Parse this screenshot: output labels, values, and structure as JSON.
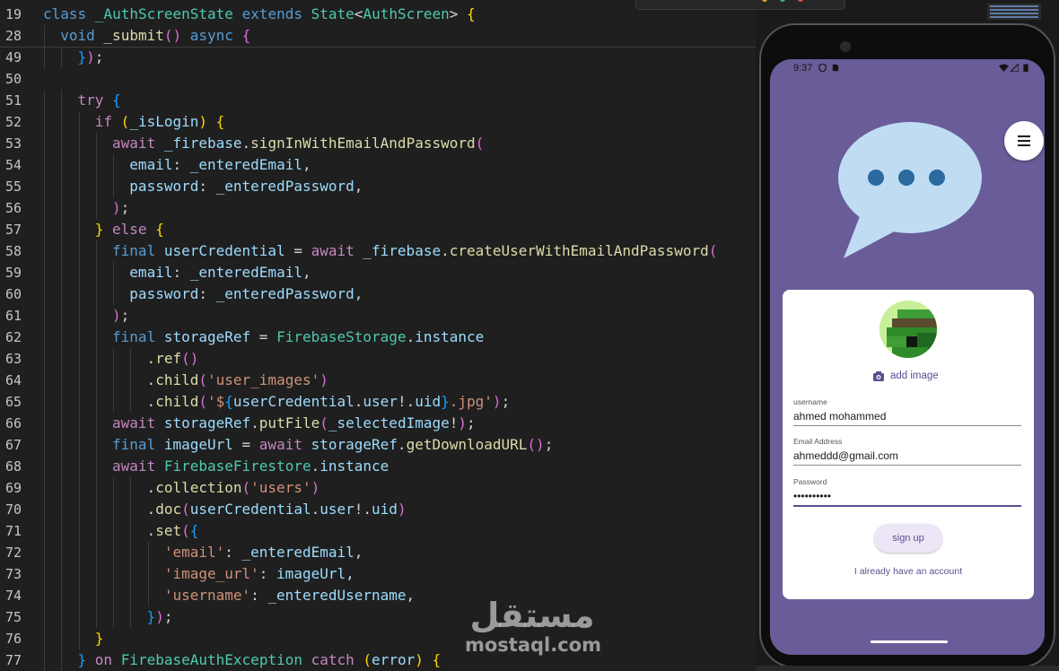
{
  "colors": {
    "editor_bg": "#1f1f1f",
    "screen_bg": "#695c99",
    "card_bg": "#ffffff",
    "accent": "#5a4f8e",
    "bubble": "#bfdcf3",
    "dots": "#2a6a9f"
  },
  "editor": {
    "lines": [
      {
        "num": "19",
        "indent": 0,
        "tokens": [
          [
            "kb",
            "class "
          ],
          [
            "t",
            "_AuthScreenState "
          ],
          [
            "kb",
            "extends "
          ],
          [
            "t",
            "State"
          ],
          [
            "p",
            "<"
          ],
          [
            "t",
            "AuthScreen"
          ],
          [
            "p",
            "> "
          ],
          [
            "br1",
            "{"
          ]
        ]
      },
      {
        "num": "28",
        "indent": 1,
        "tokens": [
          [
            "kb",
            "void "
          ],
          [
            "f",
            "_submit"
          ],
          [
            "br2",
            "()"
          ],
          [
            "kb",
            " async "
          ],
          [
            "br2",
            "{"
          ]
        ]
      },
      {
        "num": "49",
        "indent": 2,
        "tokens": [
          [
            "br3",
            "}"
          ],
          [
            "br2",
            ")"
          ],
          [
            "p",
            ";"
          ]
        ]
      },
      {
        "num": "50",
        "indent": 0,
        "tokens": []
      },
      {
        "num": "51",
        "indent": 2,
        "tokens": [
          [
            "k",
            "try "
          ],
          [
            "br3",
            "{"
          ]
        ]
      },
      {
        "num": "52",
        "indent": 3,
        "tokens": [
          [
            "k",
            "if "
          ],
          [
            "br1",
            "("
          ],
          [
            "v",
            "_isLogin"
          ],
          [
            "br1",
            ")"
          ],
          [
            "p",
            " "
          ],
          [
            "br1",
            "{"
          ]
        ]
      },
      {
        "num": "53",
        "indent": 4,
        "tokens": [
          [
            "k",
            "await "
          ],
          [
            "v",
            "_firebase"
          ],
          [
            "p",
            "."
          ],
          [
            "f",
            "signInWithEmailAndPassword"
          ],
          [
            "br2",
            "("
          ]
        ]
      },
      {
        "num": "54",
        "indent": 5,
        "tokens": [
          [
            "v",
            "email"
          ],
          [
            "p",
            ": "
          ],
          [
            "v",
            "_enteredEmail"
          ],
          [
            "p",
            ","
          ]
        ]
      },
      {
        "num": "55",
        "indent": 5,
        "tokens": [
          [
            "v",
            "password"
          ],
          [
            "p",
            ": "
          ],
          [
            "v",
            "_enteredPassword"
          ],
          [
            "p",
            ","
          ]
        ]
      },
      {
        "num": "56",
        "indent": 4,
        "tokens": [
          [
            "br2",
            ")"
          ],
          [
            "p",
            ";"
          ]
        ]
      },
      {
        "num": "57",
        "indent": 3,
        "tokens": [
          [
            "br1",
            "} "
          ],
          [
            "k",
            "else "
          ],
          [
            "br1",
            "{"
          ]
        ]
      },
      {
        "num": "58",
        "indent": 4,
        "tokens": [
          [
            "kb",
            "final "
          ],
          [
            "v",
            "userCredential "
          ],
          [
            "p",
            "= "
          ],
          [
            "k",
            "await "
          ],
          [
            "v",
            "_firebase"
          ],
          [
            "p",
            "."
          ],
          [
            "f",
            "createUserWithEmailAndPassword"
          ],
          [
            "br2",
            "("
          ]
        ]
      },
      {
        "num": "59",
        "indent": 5,
        "tokens": [
          [
            "v",
            "email"
          ],
          [
            "p",
            ": "
          ],
          [
            "v",
            "_enteredEmail"
          ],
          [
            "p",
            ","
          ]
        ]
      },
      {
        "num": "60",
        "indent": 5,
        "tokens": [
          [
            "v",
            "password"
          ],
          [
            "p",
            ": "
          ],
          [
            "v",
            "_enteredPassword"
          ],
          [
            "p",
            ","
          ]
        ]
      },
      {
        "num": "61",
        "indent": 4,
        "tokens": [
          [
            "br2",
            ")"
          ],
          [
            "p",
            ";"
          ]
        ]
      },
      {
        "num": "62",
        "indent": 4,
        "tokens": [
          [
            "kb",
            "final "
          ],
          [
            "v",
            "storageRef "
          ],
          [
            "p",
            "= "
          ],
          [
            "t",
            "FirebaseStorage"
          ],
          [
            "p",
            "."
          ],
          [
            "v",
            "instance"
          ]
        ]
      },
      {
        "num": "63",
        "indent": 6,
        "tokens": [
          [
            "p",
            "."
          ],
          [
            "f",
            "ref"
          ],
          [
            "br2",
            "()"
          ]
        ]
      },
      {
        "num": "64",
        "indent": 6,
        "tokens": [
          [
            "p",
            "."
          ],
          [
            "f",
            "child"
          ],
          [
            "br2",
            "("
          ],
          [
            "s",
            "'user_images'"
          ],
          [
            "br2",
            ")"
          ]
        ]
      },
      {
        "num": "65",
        "indent": 6,
        "tokens": [
          [
            "p",
            "."
          ],
          [
            "f",
            "child"
          ],
          [
            "br2",
            "("
          ],
          [
            "s",
            "'$"
          ],
          [
            "br3",
            "{"
          ],
          [
            "v",
            "userCredential"
          ],
          [
            "p",
            "."
          ],
          [
            "v",
            "user"
          ],
          [
            "p",
            "!."
          ],
          [
            "v",
            "uid"
          ],
          [
            "br3",
            "}"
          ],
          [
            "s",
            ".jpg'"
          ],
          [
            "br2",
            ")"
          ],
          [
            "p",
            ";"
          ]
        ]
      },
      {
        "num": "66",
        "indent": 4,
        "tokens": [
          [
            "k",
            "await "
          ],
          [
            "v",
            "storageRef"
          ],
          [
            "p",
            "."
          ],
          [
            "f",
            "putFile"
          ],
          [
            "br2",
            "("
          ],
          [
            "v",
            "_selectedImage"
          ],
          [
            "p",
            "!"
          ],
          [
            "br2",
            ")"
          ],
          [
            "p",
            ";"
          ]
        ]
      },
      {
        "num": "67",
        "indent": 4,
        "tokens": [
          [
            "kb",
            "final "
          ],
          [
            "v",
            "imageUrl "
          ],
          [
            "p",
            "= "
          ],
          [
            "k",
            "await "
          ],
          [
            "v",
            "storageRef"
          ],
          [
            "p",
            "."
          ],
          [
            "f",
            "getDownloadURL"
          ],
          [
            "br2",
            "()"
          ],
          [
            "p",
            ";"
          ]
        ]
      },
      {
        "num": "68",
        "indent": 4,
        "tokens": [
          [
            "k",
            "await "
          ],
          [
            "t",
            "FirebaseFirestore"
          ],
          [
            "p",
            "."
          ],
          [
            "v",
            "instance"
          ]
        ]
      },
      {
        "num": "69",
        "indent": 6,
        "tokens": [
          [
            "p",
            "."
          ],
          [
            "f",
            "collection"
          ],
          [
            "br2",
            "("
          ],
          [
            "s",
            "'users'"
          ],
          [
            "br2",
            ")"
          ]
        ]
      },
      {
        "num": "70",
        "indent": 6,
        "tokens": [
          [
            "p",
            "."
          ],
          [
            "f",
            "doc"
          ],
          [
            "br2",
            "("
          ],
          [
            "v",
            "userCredential"
          ],
          [
            "p",
            "."
          ],
          [
            "v",
            "user"
          ],
          [
            "p",
            "!."
          ],
          [
            "v",
            "uid"
          ],
          [
            "br2",
            ")"
          ]
        ]
      },
      {
        "num": "71",
        "indent": 6,
        "tokens": [
          [
            "p",
            "."
          ],
          [
            "f",
            "set"
          ],
          [
            "br2",
            "("
          ],
          [
            "br3",
            "{"
          ]
        ]
      },
      {
        "num": "72",
        "indent": 7,
        "tokens": [
          [
            "s",
            "'email'"
          ],
          [
            "p",
            ": "
          ],
          [
            "v",
            "_enteredEmail"
          ],
          [
            "p",
            ","
          ]
        ]
      },
      {
        "num": "73",
        "indent": 7,
        "tokens": [
          [
            "s",
            "'image_url'"
          ],
          [
            "p",
            ": "
          ],
          [
            "v",
            "imageUrl"
          ],
          [
            "p",
            ","
          ]
        ]
      },
      {
        "num": "74",
        "indent": 7,
        "tokens": [
          [
            "s",
            "'username'"
          ],
          [
            "p",
            ": "
          ],
          [
            "v",
            "_enteredUsername"
          ],
          [
            "p",
            ","
          ]
        ]
      },
      {
        "num": "75",
        "indent": 6,
        "tokens": [
          [
            "br3",
            "}"
          ],
          [
            "br2",
            ")"
          ],
          [
            "p",
            ";"
          ]
        ]
      },
      {
        "num": "76",
        "indent": 3,
        "tokens": [
          [
            "br1",
            "}"
          ]
        ]
      },
      {
        "num": "77",
        "indent": 2,
        "tokens": [
          [
            "br3",
            "} "
          ],
          [
            "k",
            "on "
          ],
          [
            "t",
            "FirebaseAuthException "
          ],
          [
            "k",
            "catch "
          ],
          [
            "br1",
            "("
          ],
          [
            "v",
            "error"
          ],
          [
            "br1",
            ")"
          ],
          [
            "p",
            " "
          ],
          [
            "br1",
            "{"
          ]
        ]
      }
    ]
  },
  "watermark": {
    "arabic": "مستقل",
    "latin": "mostaql.com"
  },
  "phone": {
    "status_bar": {
      "time": "9:37"
    },
    "menu_icon": "menu-icon",
    "art_icon": "chat-bubble-icon",
    "card": {
      "add_image_label": "add image",
      "camera_icon": "add-photo-icon",
      "fields": [
        {
          "label": "username",
          "value": "ahmed mohammed"
        },
        {
          "label": "Email Address",
          "value": "ahmeddd@gmail.com"
        },
        {
          "label": "Password",
          "value": "••••••••••"
        }
      ],
      "submit_label": "sign up",
      "switch_label": "I already have an account"
    }
  }
}
